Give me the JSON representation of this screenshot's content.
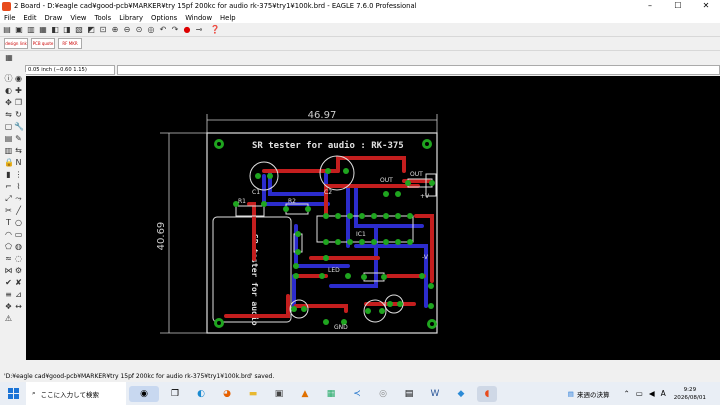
{
  "window": {
    "title": "2 Board - D:¥eagle cad¥good-pcb¥MARKER¥try 15pf  200kc for audio  rk-375¥try1¥100k.brd - EAGLE 7.6.0 Professional",
    "controls": [
      "–",
      "☐",
      "✕"
    ]
  },
  "menu": [
    "File",
    "Edit",
    "Draw",
    "View",
    "Tools",
    "Library",
    "Options",
    "Window",
    "Help"
  ],
  "toolbar2": [
    "design link",
    "PCB quote",
    "RF MKR"
  ],
  "command": {
    "coordinates": "0.05 inch (−0.60 1.15)",
    "input_value": ""
  },
  "board": {
    "title": "SR tester for audio  :  RK-375",
    "mirror_text": "SR tester for audio",
    "width_dim": "46.97",
    "height_dim": "40.69",
    "labels": [
      "OUT",
      "+V",
      "-V",
      "GND",
      "R1",
      "R2",
      "C1",
      "C2",
      "IC1",
      "OUT",
      "LED"
    ]
  },
  "status": "'D:¥eagle cad¥good-pcb¥MARKER¥try 15pf  200kc for audio  rk-375¥try1¥100k.brd' saved.",
  "taskbar": {
    "search_placeholder": "ここに入力して検索",
    "weather": "来週の決算",
    "time": "9:29",
    "date": "2026/08/01"
  },
  "colors": {
    "board_outline": "#e0e0e0",
    "top_copper": "#c41e1e",
    "bottom_copper": "#2c2ccc",
    "pads": "#1fa51f",
    "dimension": "#cccccc"
  }
}
